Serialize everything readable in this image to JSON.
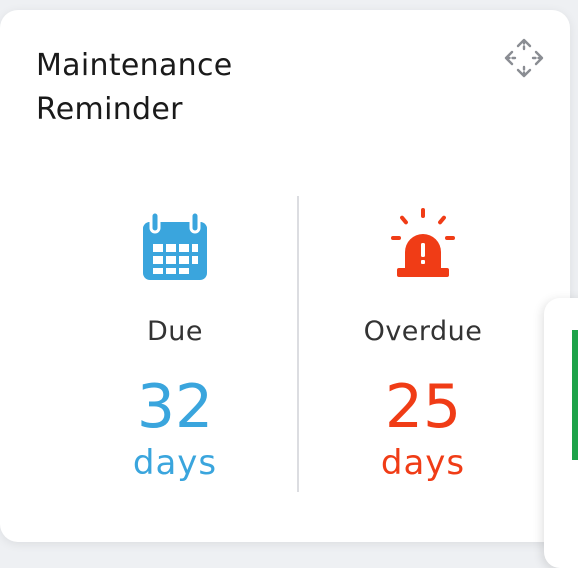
{
  "widget": {
    "title": "Maintenance Reminder",
    "move_icon": "move-arrows-icon"
  },
  "due": {
    "label": "Due",
    "value": "32",
    "unit": "days",
    "icon": "calendar-icon",
    "color": "#3aa5dd"
  },
  "overdue": {
    "label": "Overdue",
    "value": "25",
    "unit": "days",
    "icon": "alarm-siren-icon",
    "color": "#f03c16"
  },
  "adjacent_card": {
    "accent_color": "#1ea34a"
  }
}
